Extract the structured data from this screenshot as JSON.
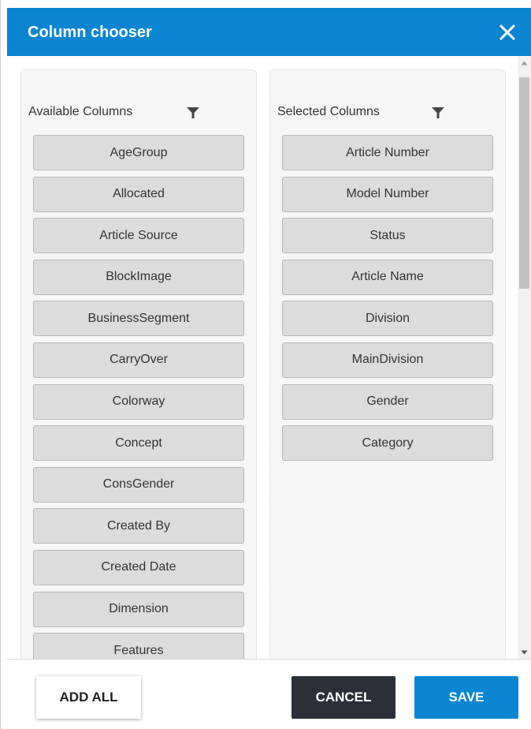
{
  "dialog": {
    "title": "Column chooser",
    "close_icon": "close-icon"
  },
  "available": {
    "title": "Available Columns",
    "filter_icon": "filter-icon",
    "items": [
      "AgeGroup",
      "Allocated",
      "Article Source",
      "BlockImage",
      "BusinessSegment",
      "CarryOver",
      "Colorway",
      "Concept",
      "ConsGender",
      "Created By",
      "Created Date",
      "Dimension",
      "Features"
    ]
  },
  "selected": {
    "title": "Selected Columns",
    "filter_icon": "filter-icon",
    "items": [
      "Article Number",
      "Model Number",
      "Status",
      "Article Name",
      "Division",
      "MainDivision",
      "Gender",
      "Category"
    ]
  },
  "footer": {
    "add_all_label": "ADD ALL",
    "cancel_label": "CANCEL",
    "save_label": "SAVE"
  },
  "colors": {
    "header_bg": "#0a85d1",
    "save_bg": "#0a85d1",
    "cancel_bg": "#2b3038",
    "chip_bg": "#dcdcdc"
  }
}
